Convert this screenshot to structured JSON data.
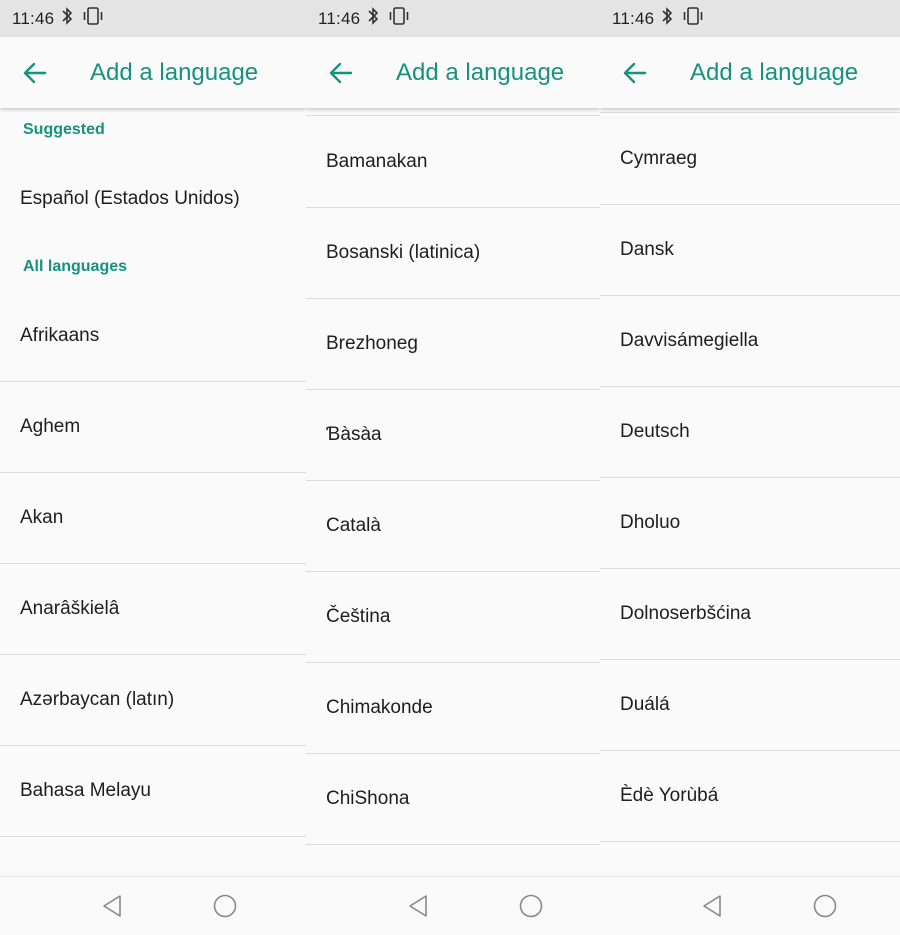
{
  "status": {
    "time": "11:46"
  },
  "appbar": {
    "title": "Add a language"
  },
  "panel1": {
    "suggested_header": "Suggested",
    "suggested_item": "Español (Estados Unidos)",
    "all_header": "All languages",
    "items": [
      "Afrikaans",
      "Aghem",
      "Akan",
      "Anarâškielâ",
      "Azərbaycan (latın)",
      "Bahasa Melayu"
    ]
  },
  "panel2": {
    "items": [
      "Bamanakan",
      "Bosanski (latinica)",
      "Brezhoneg",
      "Ɓàsàa",
      "Català",
      "Čeština",
      "Chimakonde",
      "ChiShona"
    ]
  },
  "panel3": {
    "items": [
      "Cymraeg",
      "Dansk",
      "Davvisámegiella",
      "Deutsch",
      "Dholuo",
      "Dolnoserbšćina",
      "Duálá",
      "Èdè Yorùbá"
    ]
  },
  "icons": [
    "bluetooth-icon",
    "vibrate-icon",
    "back-arrow-icon",
    "nav-back-icon",
    "nav-home-icon"
  ],
  "colors": {
    "accent": "#17927f",
    "statusbar": "#e4e4e4",
    "background": "#fafafa"
  }
}
